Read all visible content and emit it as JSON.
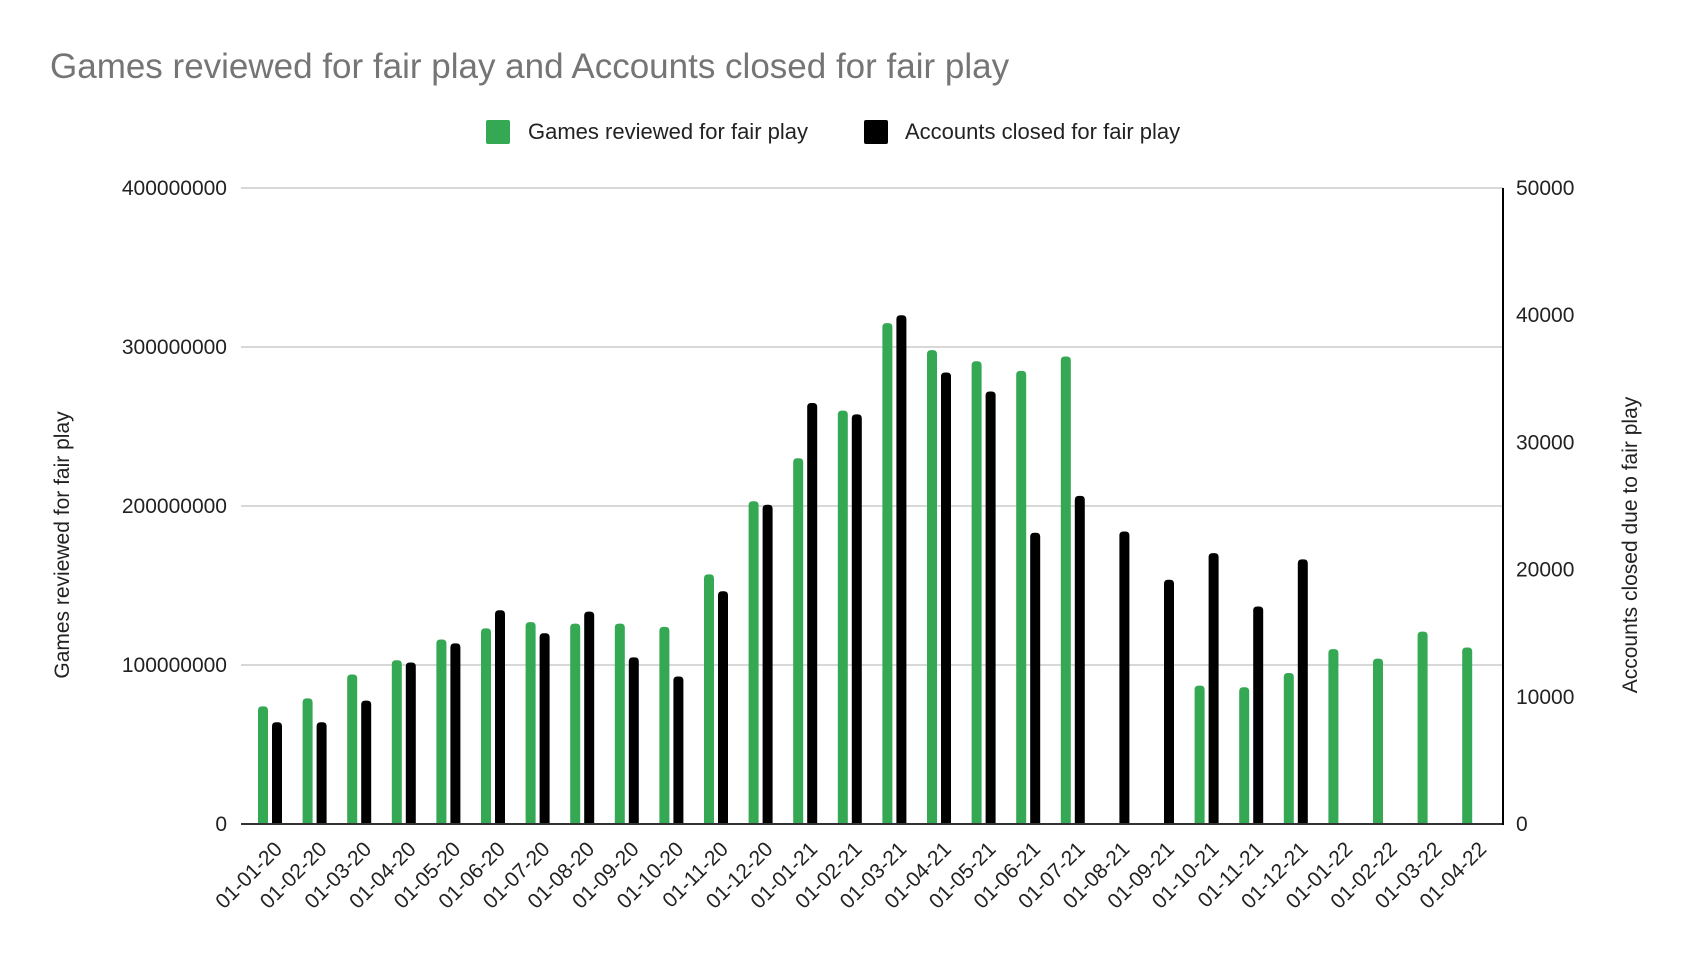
{
  "chart_data": {
    "type": "bar",
    "title": "Games reviewed for fair play and Accounts closed for fair play",
    "legend": {
      "position": "top",
      "entries": [
        {
          "label": "Games reviewed for fair play",
          "color": "#34a853"
        },
        {
          "label": "Accounts closed for fair play",
          "color": "#000000"
        }
      ]
    },
    "categories": [
      "01-01-20",
      "01-02-20",
      "01-03-20",
      "01-04-20",
      "01-05-20",
      "01-06-20",
      "01-07-20",
      "01-08-20",
      "01-09-20",
      "01-10-20",
      "01-11-20",
      "01-12-20",
      "01-01-21",
      "01-02-21",
      "01-03-21",
      "01-04-21",
      "01-05-21",
      "01-06-21",
      "01-07-21",
      "01-08-21",
      "01-09-21",
      "01-10-21",
      "01-11-21",
      "01-12-21",
      "01-01-22",
      "01-02-22",
      "01-03-22",
      "01-04-22"
    ],
    "series": [
      {
        "name": "Games reviewed for fair play",
        "axis": "left",
        "color": "#34a853",
        "values": [
          74000000,
          79000000,
          94000000,
          103000000,
          116000000,
          123000000,
          127000000,
          126000000,
          126000000,
          124000000,
          157000000,
          203000000,
          230000000,
          260000000,
          315000000,
          298000000,
          291000000,
          285000000,
          294000000,
          null,
          null,
          87000000,
          86000000,
          95000000,
          110000000,
          104000000,
          121000000,
          111000000
        ]
      },
      {
        "name": "Accounts closed for fair play",
        "axis": "right",
        "color": "#000000",
        "values": [
          8000,
          8000,
          9700,
          12700,
          14200,
          16800,
          15000,
          16700,
          13100,
          11600,
          18300,
          25100,
          33100,
          32200,
          40000,
          35500,
          34000,
          22900,
          25800,
          23000,
          19200,
          21300,
          17100,
          20800,
          null,
          null,
          null,
          null
        ]
      }
    ],
    "y_left": {
      "label": "Games reviewed for fair play",
      "ylim": [
        0,
        400000000
      ],
      "ticks": [
        "0",
        "100000000",
        "200000000",
        "300000000",
        "400000000"
      ],
      "tick_values": [
        0,
        100000000,
        200000000,
        300000000,
        400000000
      ]
    },
    "y_right": {
      "label": "Accounts closed due to fair play",
      "ylim": [
        0,
        50000
      ],
      "ticks": [
        "0",
        "10000",
        "20000",
        "30000",
        "40000",
        "50000"
      ],
      "tick_values": [
        0,
        10000,
        20000,
        30000,
        40000,
        50000
      ]
    },
    "xlabel": "",
    "grid": true
  }
}
